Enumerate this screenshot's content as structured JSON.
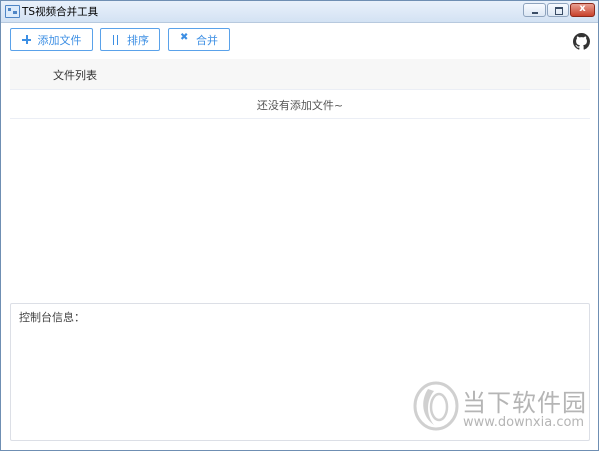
{
  "window": {
    "title": "TS视频合并工具",
    "close_glyph": "x"
  },
  "toolbar": {
    "add_label": "添加文件",
    "sort_label": "排序",
    "merge_label": "合并",
    "icons": [
      "plus-icon",
      "sort-icon",
      "merge-icon",
      "github-icon"
    ],
    "accent_color": "#3d8fe4"
  },
  "file_list": {
    "header": "文件列表",
    "empty_text": "还没有添加文件~"
  },
  "console": {
    "label": "控制台信息："
  },
  "watermark": {
    "cn": "当下软件园",
    "url": "www.downxia.com"
  }
}
